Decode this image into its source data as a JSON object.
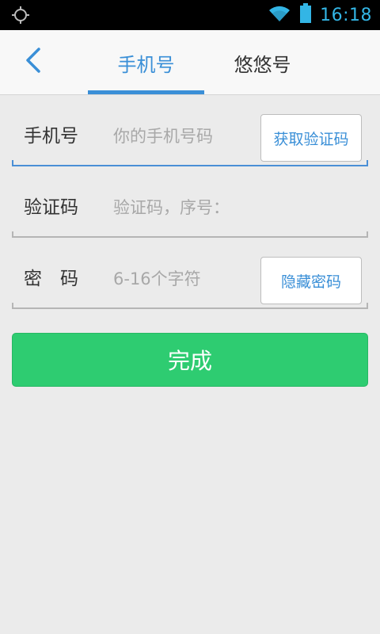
{
  "status_bar": {
    "time": "16:18",
    "left_icon": "gps-icon",
    "right_icons": [
      "wifi-icon",
      "battery-icon"
    ]
  },
  "header": {
    "back_icon": "chevron-left-icon",
    "tabs": [
      {
        "label": "手机号",
        "active": true
      },
      {
        "label": "悠悠号",
        "active": false
      }
    ]
  },
  "form": {
    "phone": {
      "label": "手机号",
      "placeholder": "你的手机号码",
      "value": "",
      "action_label": "获取验证码"
    },
    "code": {
      "label": "验证码",
      "placeholder": "验证码，序号：",
      "value": ""
    },
    "password": {
      "label": "密　码",
      "placeholder": "6-16个字符",
      "value": "",
      "action_label": "隐藏密码"
    },
    "submit_label": "完成"
  },
  "colors": {
    "accent": "#3a8fd7",
    "submit": "#2ecc71",
    "status_bar": "#000000",
    "status_text": "#33b5e5"
  }
}
